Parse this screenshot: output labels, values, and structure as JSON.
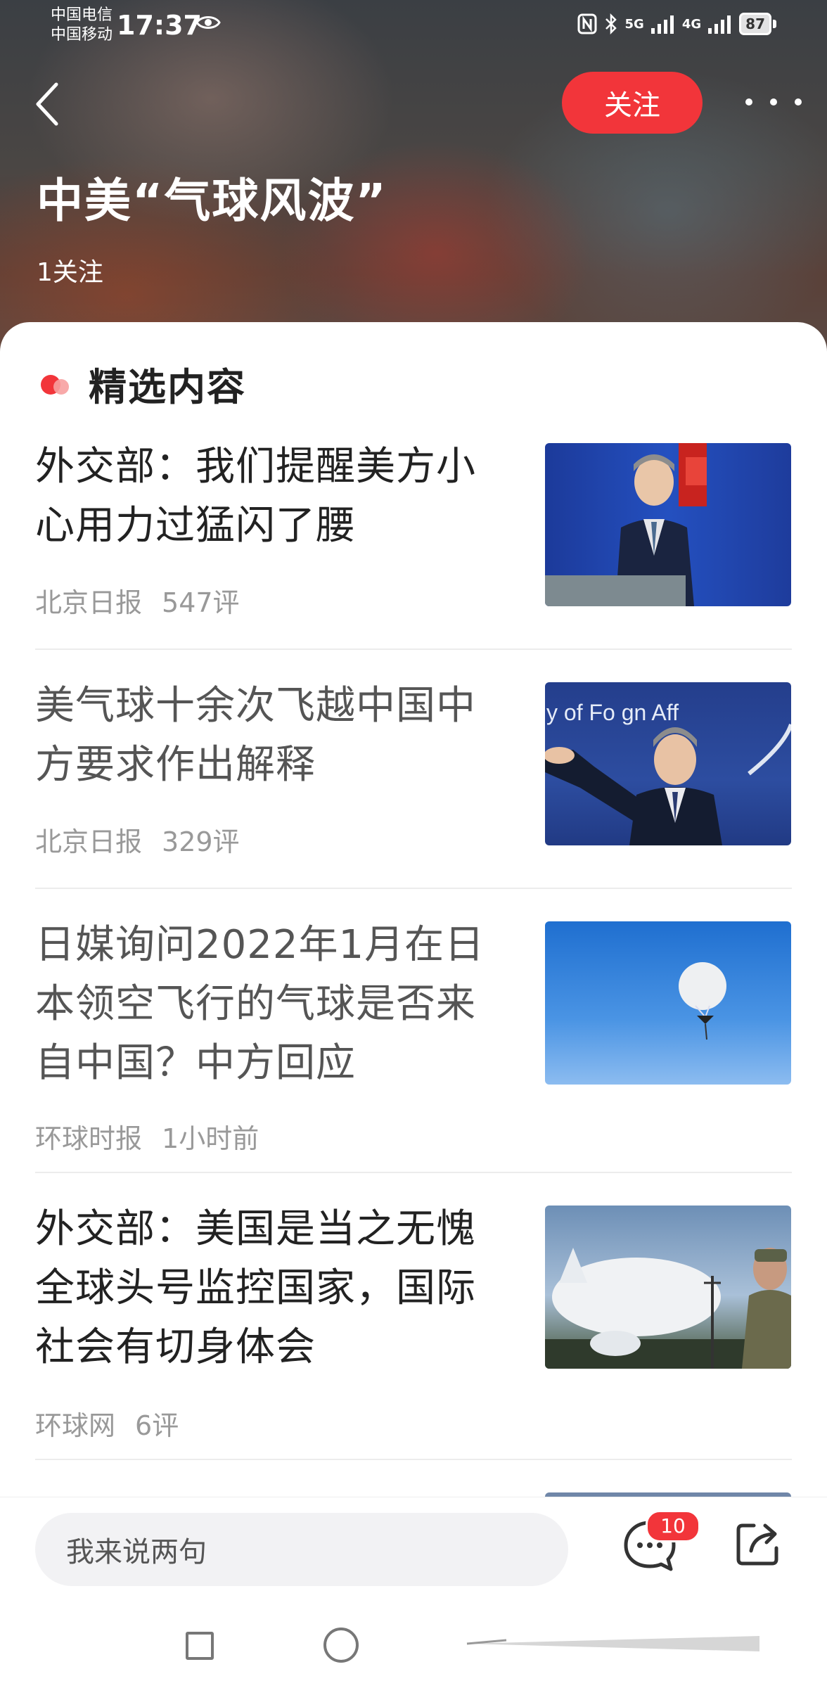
{
  "status_bar": {
    "carrier_1": "中国电信",
    "carrier_2": "中国移动",
    "time": "17:37",
    "network_1": "5G",
    "network_2": "4G",
    "battery": "87"
  },
  "header": {
    "follow_label": "关注",
    "title": "中美“气球风波”",
    "follow_count": "1关注"
  },
  "section": {
    "title": "精选内容"
  },
  "articles": [
    {
      "title": "外交部：我们提醒美方小心用力过猛闪了腰",
      "source": "北京日报",
      "stat": "547评",
      "read": false
    },
    {
      "title": "美气球十余次飞越中国中方要求作出解释",
      "source": "北京日报",
      "stat": "329评",
      "read": true
    },
    {
      "title": "日媒询问2022年1月在日本领空飞行的气球是否来自中国？中方回应",
      "source": "环球时报",
      "stat": "1小时前",
      "read": true
    },
    {
      "title": "外交部：美国是当之无愧全球头号监控国家，国际社会有切身体会",
      "source": "环球网",
      "stat": "6评",
      "read": false
    }
  ],
  "thumbnails": {
    "thumb_2_text": "y of Fo   gn Aff"
  },
  "bottom_bar": {
    "input_placeholder": "我来说两句",
    "comment_badge": "10"
  },
  "colors": {
    "accent": "#f2353a",
    "text_primary": "#222222",
    "text_secondary": "#999999"
  }
}
